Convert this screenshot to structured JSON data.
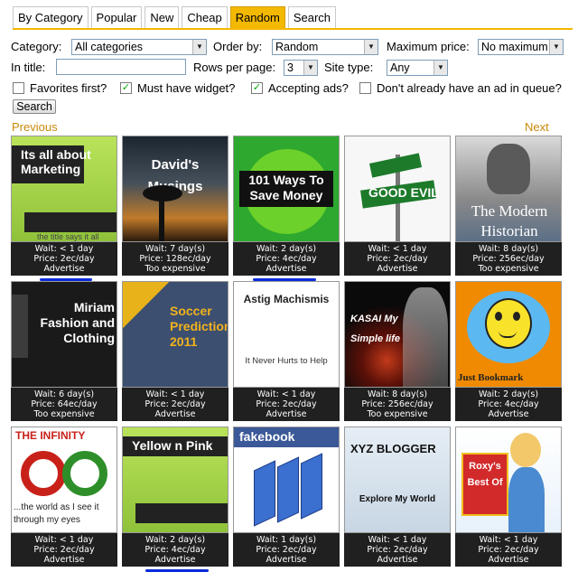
{
  "tabs": [
    {
      "label": "By Category",
      "active": false
    },
    {
      "label": "Popular",
      "active": false
    },
    {
      "label": "New",
      "active": false
    },
    {
      "label": "Cheap",
      "active": false
    },
    {
      "label": "Random",
      "active": true
    },
    {
      "label": "Search",
      "active": false
    }
  ],
  "filters": {
    "category_label": "Category:",
    "category_value": "All categories",
    "order_label": "Order by:",
    "order_value": "Random",
    "max_price_label": "Maximum price:",
    "max_price_value": "No maximum",
    "title_label": "In title:",
    "title_value": "",
    "rows_label": "Rows per page:",
    "rows_value": "3",
    "site_type_label": "Site type:",
    "site_type_value": "Any",
    "favorites_label": "Favorites first?",
    "favorites_checked": false,
    "widget_label": "Must have widget?",
    "widget_checked": true,
    "ads_label": "Accepting ads?",
    "ads_checked": true,
    "queue_label": "Don't already have an ad in queue?",
    "queue_checked": false,
    "search_button": "Search"
  },
  "pager": {
    "previous": "Previous",
    "next": "Next"
  },
  "blogs": [
    {
      "title": "Its all about Marketing",
      "subtitle": "the title says it all",
      "wait": "Wait: < 1 day",
      "price": "Price: 2ec/day",
      "action": "Advertise"
    },
    {
      "title": "David's Musings",
      "wait": "Wait: 7 day(s)",
      "price": "Price: 128ec/day",
      "action": "Too expensive"
    },
    {
      "title": "101 Ways To Save Money",
      "wait": "Wait: 2 day(s)",
      "price": "Price: 4ec/day",
      "action": "Advertise"
    },
    {
      "title": "GOOD EVIL",
      "wait": "Wait: < 1 day",
      "price": "Price: 2ec/day",
      "action": "Advertise"
    },
    {
      "title": "The Modern Historian",
      "wait": "Wait: 8 day(s)",
      "price": "Price: 256ec/day",
      "action": "Too expensive"
    },
    {
      "title": "Miriam Fashion and Clothing",
      "wait": "Wait: 6 day(s)",
      "price": "Price: 64ec/day",
      "action": "Too expensive"
    },
    {
      "title": "Soccer Predictions 2011",
      "wait": "Wait: < 1 day",
      "price": "Price: 2ec/day",
      "action": "Advertise"
    },
    {
      "title": "Astig Machismis",
      "subtitle": "It Never Hurts to Help",
      "wait": "Wait: < 1 day",
      "price": "Price: 2ec/day",
      "action": "Advertise"
    },
    {
      "title": "KASAI My Simple life",
      "wait": "Wait: 8 day(s)",
      "price": "Price: 256ec/day",
      "action": "Too expensive"
    },
    {
      "title": "Just Bookmark",
      "wait": "Wait: 2 day(s)",
      "price": "Price: 4ec/day",
      "action": "Advertise"
    },
    {
      "title": "THE INFINITY",
      "subtitle": "...the world as I see it through my eyes",
      "wait": "Wait: < 1 day",
      "price": "Price: 2ec/day",
      "action": "Advertise"
    },
    {
      "title": "Yellow n Pink",
      "wait": "Wait: 2 day(s)",
      "price": "Price: 4ec/day",
      "action": "Advertise"
    },
    {
      "title": "fakebook",
      "wait": "Wait: 1 day(s)",
      "price": "Price: 2ec/day",
      "action": "Advertise"
    },
    {
      "title": "XYZ BLOGGER",
      "subtitle": "Explore My World",
      "wait": "Wait: < 1 day",
      "price": "Price: 2ec/day",
      "action": "Advertise"
    },
    {
      "title": "Roxy's Best Of",
      "wait": "Wait: < 1 day",
      "price": "Price: 2ec/day",
      "action": "Advertise"
    }
  ],
  "colors": {
    "tab_active": "#f3b800",
    "pager_link": "#c98a0a",
    "info_bar": "#202020",
    "underline": "#0a2bdc"
  }
}
